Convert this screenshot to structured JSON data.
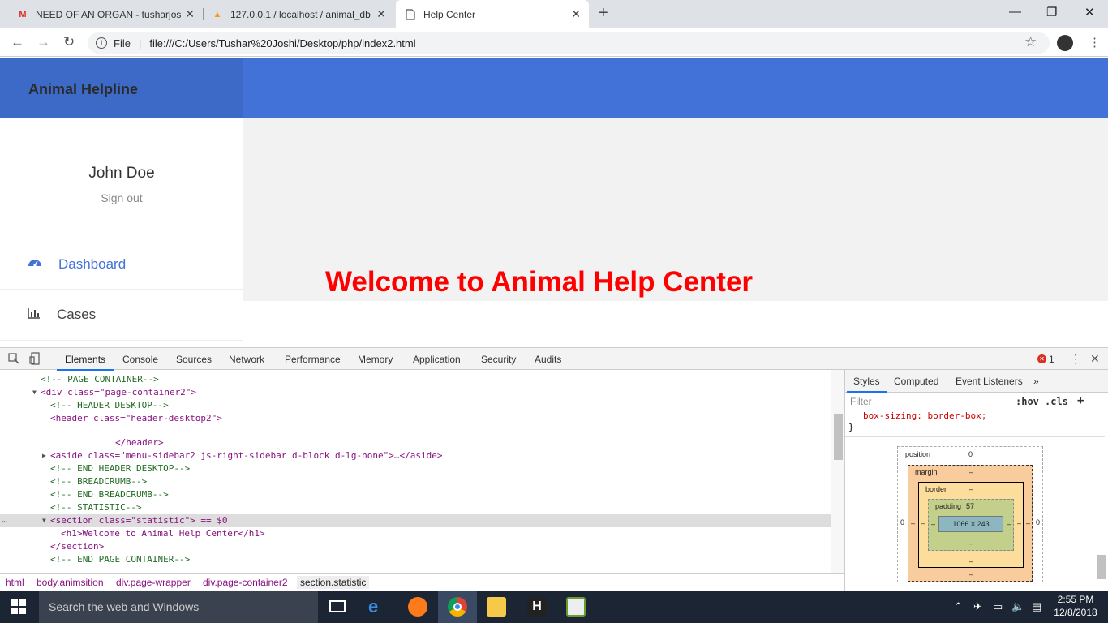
{
  "browser": {
    "tabs": [
      {
        "title": "NEED OF AN ORGAN - tusharjos",
        "icon": "gmail-icon"
      },
      {
        "title": "127.0.0.1 / localhost / animal_db",
        "icon": "phpmyadmin-icon"
      },
      {
        "title": "Help Center",
        "icon": "page-icon"
      }
    ],
    "url_scheme_label": "File",
    "url": "file:///C:/Users/Tushar%20Joshi/Desktop/php/index2.html"
  },
  "site": {
    "brand": "Animal Helpline",
    "user_name": "John Doe",
    "sign_out": "Sign out",
    "nav": [
      {
        "label": "Dashboard",
        "icon": "dashboard-icon",
        "active": true
      },
      {
        "label": "Cases",
        "icon": "bar-chart-icon",
        "active": false
      }
    ],
    "welcome": "Welcome to Animal Help Center",
    "colors": {
      "header_blue": "#4272d7",
      "brand_blue": "#3d6ac6",
      "welcome_red": "#ff0000",
      "nav_active": "#4272d7"
    }
  },
  "devtools": {
    "tabs": [
      "Elements",
      "Console",
      "Sources",
      "Network",
      "Performance",
      "Memory",
      "Application",
      "Security",
      "Audits"
    ],
    "active_tab": "Elements",
    "error_count": "1",
    "lines": [
      "<!-- PAGE CONTAINER-->",
      "<div class=\"page-container2\">",
      "<!-- HEADER DESKTOP-->",
      "<header class=\"header-desktop2\">",
      "</header>",
      "<aside class=\"menu-sidebar2 js-right-sidebar d-block d-lg-none\">…</aside>",
      "<!-- END HEADER DESKTOP-->",
      "<!-- BREADCRUMB-->",
      "<!-- END BREADCRUMB-->",
      "<!-- STATISTIC-->",
      "<section class=\"statistic\"> == $0",
      "<h1>Welcome to Animal Help Center</h1>",
      "</section>",
      "<!-- END PAGE CONTAINER-->"
    ],
    "breadcrumb": [
      "html",
      "body.animsition",
      "div.page-wrapper",
      "div.page-container2",
      "section.statistic"
    ],
    "styles_tabs": [
      "Styles",
      "Computed",
      "Event Listeners"
    ],
    "filter_placeholder": "Filter",
    "hov": ":hov",
    "cls": ".cls",
    "css_rule": "box-sizing: border-box;",
    "css_close": "}",
    "box_model": {
      "position_label": "position",
      "position_value": "0",
      "margin_label": "margin",
      "border_label": "border",
      "padding_label": "padding",
      "padding_value": "57",
      "content": "1066 × 243",
      "dash": "–",
      "side_zero": "0"
    }
  },
  "taskbar": {
    "search_placeholder": "Search the web and Windows",
    "time": "2:55 PM",
    "date": "12/8/2018"
  }
}
